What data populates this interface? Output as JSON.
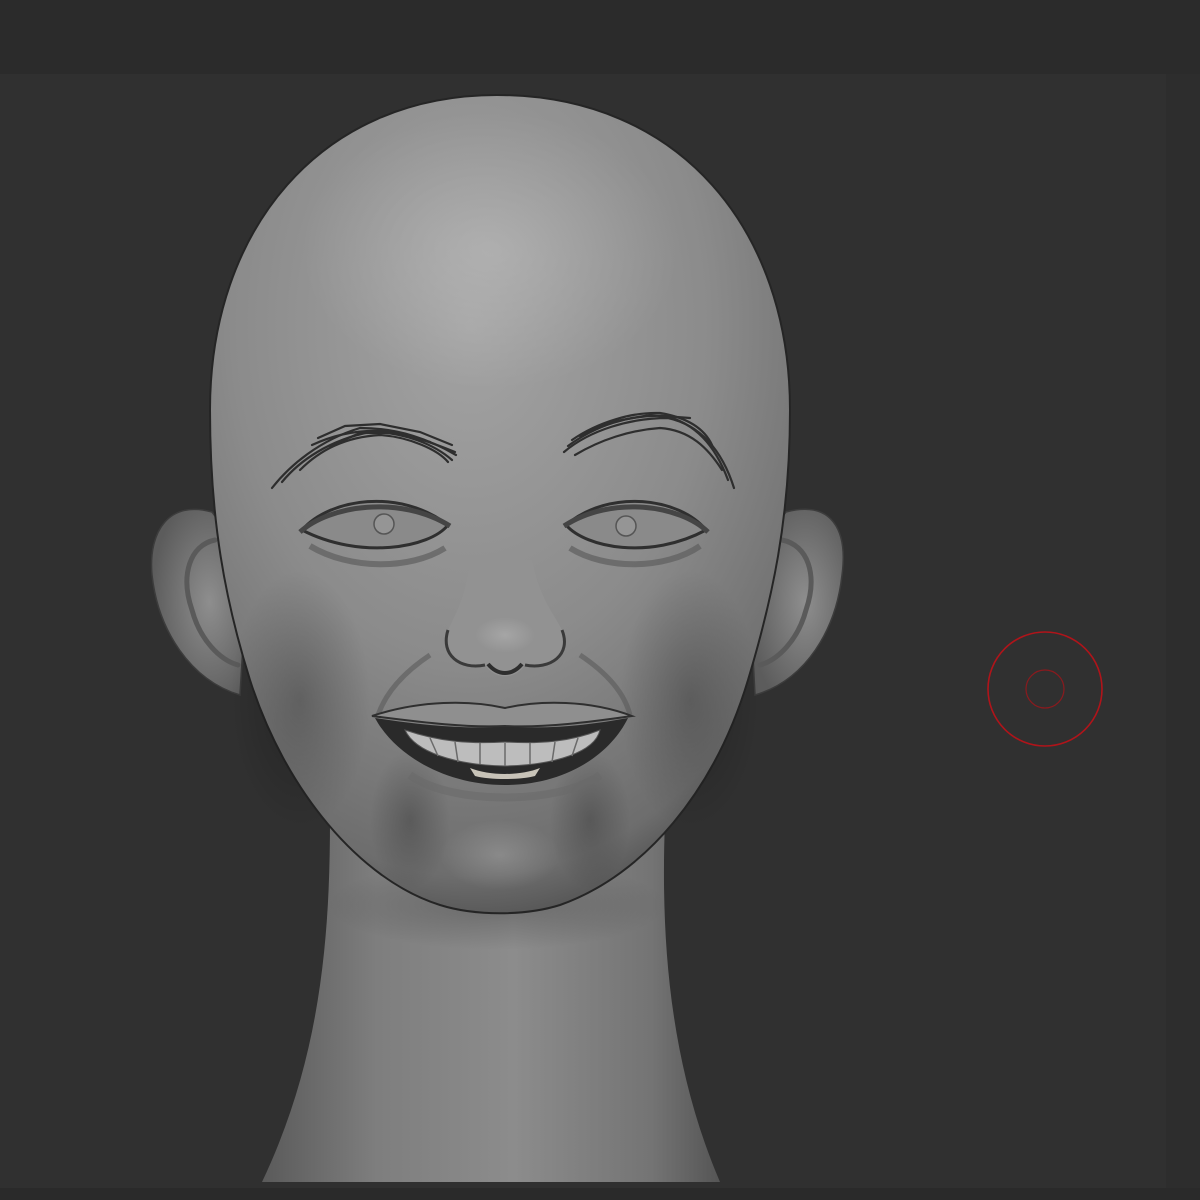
{
  "viewport": {
    "background_color": "#303030",
    "model": {
      "name": "sculpted-head",
      "material_color": "#8c8c8c",
      "teeth_color": "#c8c3b8"
    },
    "brush_cursor": {
      "color": "#b0141a"
    }
  }
}
